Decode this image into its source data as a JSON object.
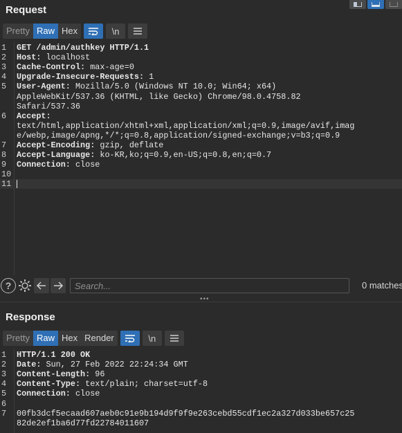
{
  "request": {
    "title": "Request",
    "tabs": [
      "Pretty",
      "Raw",
      "Hex"
    ],
    "active_tab": "Raw",
    "wrap_icon": "wrap-lines-icon",
    "newline_label": "\\n",
    "menu_icon": "hamburger-menu-icon",
    "lines": [
      {
        "n": "1",
        "key": "",
        "val": "GET /admin/authkey HTTP/1.1"
      },
      {
        "n": "2",
        "key": "Host:",
        "val": " localhost"
      },
      {
        "n": "3",
        "key": "Cache-Control:",
        "val": " max-age=0"
      },
      {
        "n": "4",
        "key": "Upgrade-Insecure-Requests:",
        "val": " 1"
      },
      {
        "n": "5",
        "key": "User-Agent:",
        "val": " Mozilla/5.0 (Windows NT 10.0; Win64; x64)"
      },
      {
        "n": "",
        "key": "",
        "val": "AppleWebKit/537.36 (KHTML, like Gecko) Chrome/98.0.4758.82"
      },
      {
        "n": "",
        "key": "",
        "val": "Safari/537.36"
      },
      {
        "n": "6",
        "key": "Accept:",
        "val": ""
      },
      {
        "n": "",
        "key": "",
        "val": "text/html,application/xhtml+xml,application/xml;q=0.9,image/avif,imag"
      },
      {
        "n": "",
        "key": "",
        "val": "e/webp,image/apng,*/*;q=0.8,application/signed-exchange;v=b3;q=0.9"
      },
      {
        "n": "7",
        "key": "Accept-Encoding:",
        "val": " gzip, deflate"
      },
      {
        "n": "8",
        "key": "Accept-Language:",
        "val": " ko-KR,ko;q=0.9,en-US;q=0.8,en;q=0.7"
      },
      {
        "n": "9",
        "key": "Connection:",
        "val": " close"
      },
      {
        "n": "10",
        "key": "",
        "val": ""
      },
      {
        "n": "11",
        "key": "",
        "val": ""
      }
    ]
  },
  "search": {
    "placeholder": "Search...",
    "matches": "0 matches",
    "help_icon": "help-icon",
    "settings_icon": "gear-icon",
    "prev_icon": "arrow-left-icon",
    "next_icon": "arrow-right-icon"
  },
  "response": {
    "title": "Response",
    "tabs": [
      "Pretty",
      "Raw",
      "Hex",
      "Render"
    ],
    "active_tab": "Raw",
    "newline_label": "\\n",
    "lines": [
      {
        "n": "1",
        "key": "",
        "val": "HTTP/1.1 200 OK"
      },
      {
        "n": "2",
        "key": "Date:",
        "val": " Sun, 27 Feb 2022 22:24:34 GMT"
      },
      {
        "n": "3",
        "key": "Content-Length:",
        "val": " 96"
      },
      {
        "n": "4",
        "key": "Content-Type:",
        "val": " text/plain; charset=utf-8"
      },
      {
        "n": "5",
        "key": "Connection:",
        "val": " close"
      },
      {
        "n": "6",
        "key": "",
        "val": ""
      },
      {
        "n": "7",
        "key": "",
        "val": "00fb3dcf5ecaad607aeb0c91e9b194d9f9f9e263cebd55cdf1ec2a327d033be657c25"
      },
      {
        "n": "",
        "key": "",
        "val": "82de2ef1ba6d77fd22784011607"
      }
    ]
  },
  "colors": {
    "accent": "#2f6fb5",
    "background": "#2b2b2b"
  }
}
